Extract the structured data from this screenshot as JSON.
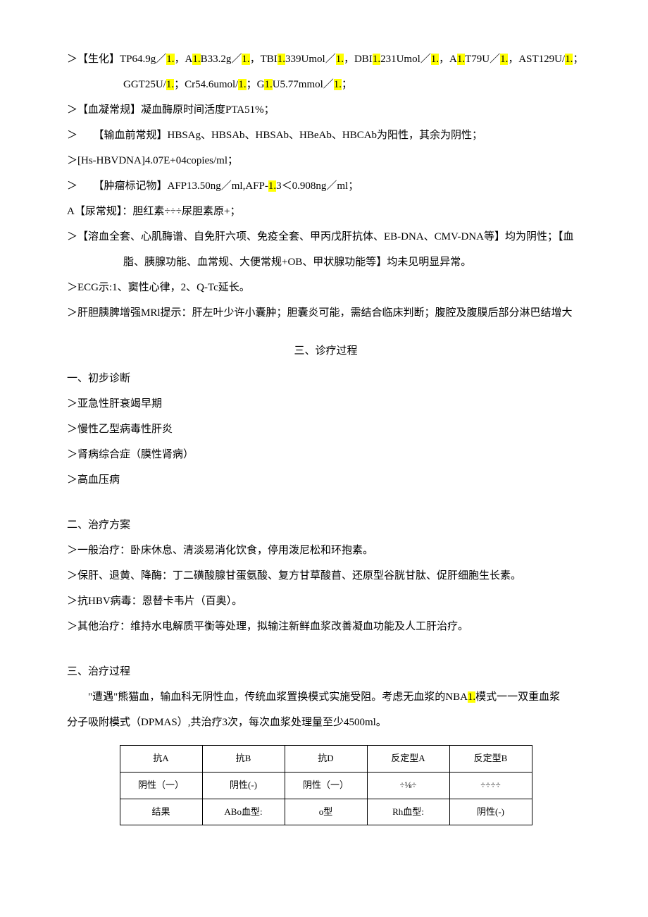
{
  "lines": {
    "l1a": "＞【生化】TP64.9g／",
    "l1b": "，A",
    "l1c": "B33.2g／",
    "l1d": "，TBI",
    "l1e": "339Umol／",
    "l1f": "，DBI",
    "l1g": "231Umol／",
    "l1h": "，A",
    "l1i": "T79U／",
    "l1j": "，AST129U/",
    "l1k": "；",
    "l2a": "GGT25U/",
    "l2b": "；Cr54.6umol/",
    "l2c": "；G",
    "l2d": "U5.77mmol／",
    "l2e": "；",
    "l3": "＞【血凝常规】凝血酶原时间活度PTA51%；",
    "l4": "＞　　【输血前常规】HBSAg、HBSAb、HBSAb、HBeAb、HBCAb为阳性，其余为阴性；",
    "l5": "＞[Hs-HBVDNA]4.07E+04copies/ml；",
    "l6a": "＞　　【肿瘤标记物】AFP13.50ng／ml,AFP-",
    "l6b": "3＜0.908ng／ml；",
    "l7": "A【尿常规】：胆红素÷÷÷尿胆素原+；",
    "l8": "＞【溶血全套、心肌酶谱、自免肝六项、免疫全套、甲丙戊肝抗体、EB-DNA、CMV-DNA等】均为阴性；【血",
    "l8b": "脂、胰腺功能、血常规、大便常规+OB、甲状腺功能等】均未见明显异常。",
    "l9": "＞ECG示:1、窦性心律，2、Q-Tc延长。",
    "l10": "＞肝胆胰脾增强MRl提示：肝左叶少许小囊肿；胆囊炎可能，需结合临床判断；腹腔及腹膜后部分淋巴结增大",
    "section3": "三、诊疗过程",
    "h1": "一、初步诊断",
    "d1": "＞亚急性肝衰竭早期",
    "d2": "＞慢性乙型病毒性肝炎",
    "d3": "＞肾病综合症（膜性肾病）",
    "d4": "＞高血压病",
    "h2": "二、治疗方案",
    "t1": "＞一般治疗：卧床休息、清淡易消化饮食，停用泼尼松和环抱素。",
    "t2": "＞保肝、退黄、降酶：丁二磺酸腺甘蛋氨酸、复方甘草酸苜、还原型谷胱甘肽、促肝细胞生长素。",
    "t3": "＞抗HBV病毒：恩替卡韦片（百奥）。",
    "t4": "＞其他治疗：维持水电解质平衡等处理，拟输注新鲜血浆改善凝血功能及人工肝治疗。",
    "h3": "三、治疗过程",
    "p3a": "\"遭遇\"熊猫血，输血科无阴性血，传统血浆置换模式实施受阻。考虑无血浆的NBA",
    "p3b": "模式一一双重血浆",
    "p3c": "分子吸附模式（DPMAS）,共治疗3次，每次血浆处理量至少4500ml。"
  },
  "hl": {
    "one_dot": "1.",
    "one_dot2": "1."
  },
  "table": {
    "h": [
      "抗A",
      "抗B",
      "抗D",
      "反定型A",
      "反定型B"
    ],
    "r1": [
      "阴性（一）",
      "阴性(-)",
      "阴性（一）",
      "÷⅛÷",
      "÷÷÷÷"
    ],
    "r2": [
      "结果",
      "ABo血型:",
      "o型",
      "Rh血型:",
      "阴性(-)"
    ]
  }
}
